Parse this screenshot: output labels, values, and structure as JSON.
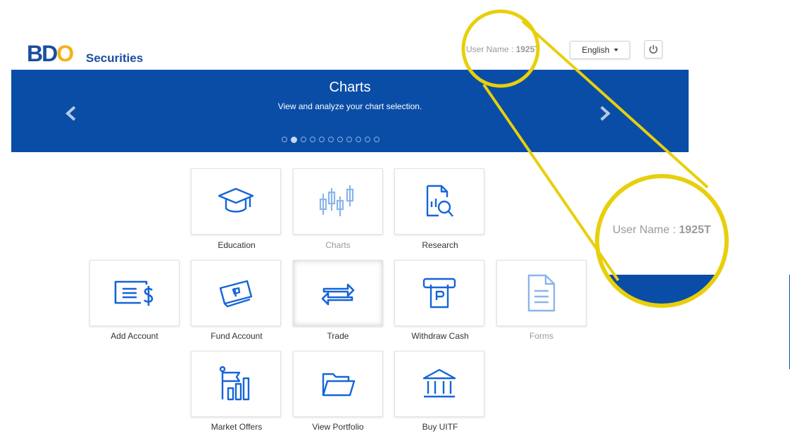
{
  "brand": {
    "logo_bdo": "BDO",
    "logo_securities": "Securities"
  },
  "header": {
    "username_label": "User Name :",
    "username_value": "1925T",
    "language": "English"
  },
  "banner": {
    "title": "Charts",
    "subtitle": "View and analyze your chart selection.",
    "slides_total": 11,
    "slide_active": 2
  },
  "tiles": [
    {
      "label": "Education",
      "icon": "graduation-cap-icon"
    },
    {
      "label": "Charts",
      "icon": "candlestick-chart-icon"
    },
    {
      "label": "Research",
      "icon": "document-search-icon"
    },
    {
      "label": "Add Account",
      "icon": "account-card-icon"
    },
    {
      "label": "Fund Account",
      "icon": "fund-card-icon"
    },
    {
      "label": "Trade",
      "icon": "trade-arrows-icon"
    },
    {
      "label": "Withdraw Cash",
      "icon": "withdraw-cash-icon"
    },
    {
      "label": "Forms",
      "icon": "form-document-icon"
    },
    {
      "label": "Market Offers",
      "icon": "flag-bar-chart-icon"
    },
    {
      "label": "View Portfolio",
      "icon": "folder-icon"
    },
    {
      "label": "Buy UITF",
      "icon": "bank-icon"
    }
  ],
  "zoom_callout": {
    "username_label": "User Name :",
    "username_value": "1925T"
  },
  "colors": {
    "brand_blue": "#0a4da6",
    "icon_blue": "#1565d8",
    "highlight_yellow": "#e8cf0c"
  }
}
